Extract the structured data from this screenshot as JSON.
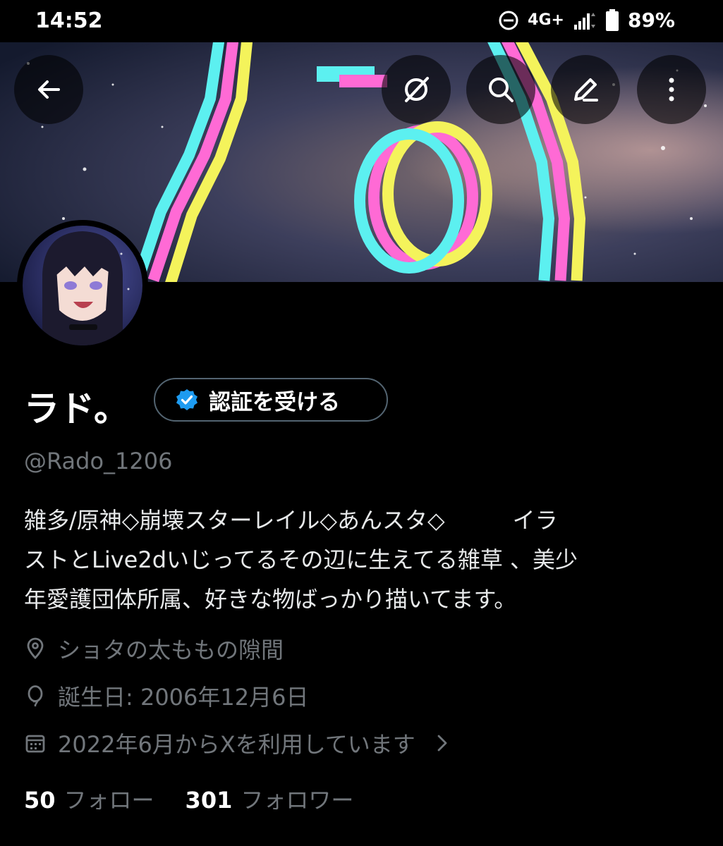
{
  "status_bar": {
    "time": "14:52",
    "network": "4G+",
    "battery": "89%",
    "icons": [
      "do-not-disturb-icon",
      "signal-icon",
      "battery-icon"
    ]
  },
  "header": {
    "buttons": [
      "back-arrow-icon",
      "grok-icon",
      "search-icon",
      "edit-icon",
      "more-vertical-icon"
    ]
  },
  "profile": {
    "display_name": "ラド。",
    "verify_label": "認証を受ける",
    "handle": "@Rado_1206",
    "bio_lines": [
      "雑多/原神◇崩壊スターレイル◇あんスタ◇　　　イラ",
      "ストとLive2dいじってるその辺に生えてる雑草 、美少",
      "年愛護団体所属、好きな物ばっかり描いてます。"
    ],
    "location": "ショタの太ももの隙間",
    "birthday": "誕生日: 2006年12月6日",
    "joined": "2022年6月からXを利用しています",
    "following_count": "50",
    "following_label": "フォロー",
    "followers_count": "301",
    "followers_label": "フォロワー"
  },
  "colors": {
    "background": "#000000",
    "text": "#e7e9ea",
    "muted": "#71767b",
    "verified": "#1d9bf0",
    "border": "#536471"
  }
}
